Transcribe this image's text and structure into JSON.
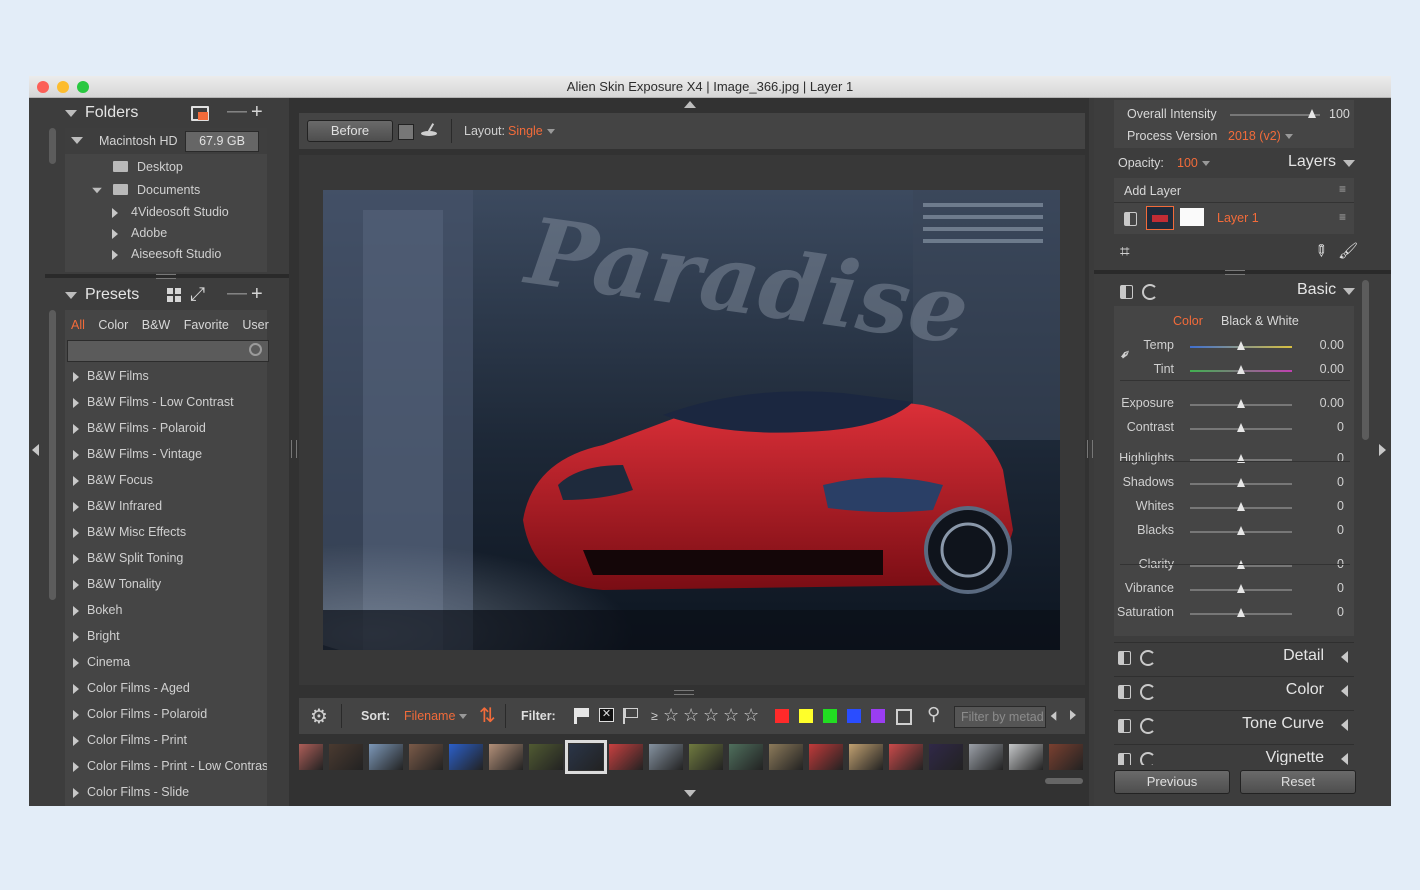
{
  "window": {
    "title": "Alien Skin Exposure X4 | Image_366.jpg | Layer 1"
  },
  "folders": {
    "header": "Folders",
    "drive_name": "Macintosh HD",
    "drive_size": "67.9 GB",
    "items": [
      {
        "label": "Desktop"
      },
      {
        "label": "Documents"
      },
      {
        "label": "4Videosoft Studio"
      },
      {
        "label": "Adobe"
      },
      {
        "label": "Aiseesoft Studio"
      }
    ]
  },
  "presets": {
    "header": "Presets",
    "filter_tabs": [
      "All",
      "Color",
      "B&W",
      "Favorite",
      "User"
    ],
    "active_tab": "All",
    "search_placeholder": "",
    "items": [
      "B&W Films",
      "B&W Films - Low Contrast",
      "B&W Films - Polaroid",
      "B&W Films - Vintage",
      "B&W Focus",
      "B&W Infrared",
      "B&W Misc Effects",
      "B&W Split Toning",
      "B&W Tonality",
      "Bokeh",
      "Bright",
      "Cinema",
      "Color Films - Aged",
      "Color Films - Polaroid",
      "Color Films - Print",
      "Color Films - Print - Low Contrast",
      "Color Films - Slide"
    ]
  },
  "toolbar": {
    "before_label": "Before",
    "layout_label": "Layout:",
    "layout_value": "Single"
  },
  "image": {
    "title_text": "Paradise"
  },
  "filmstrip_bar": {
    "sort_label": "Sort:",
    "sort_value": "Filename",
    "filter_label": "Filter:",
    "rating_prefix": "≥",
    "filter_placeholder": "Filter by metad",
    "color_labels": [
      "#ff2a2a",
      "#ffff2a",
      "#22dd22",
      "#2a4dff",
      "#9a3df2"
    ]
  },
  "thumbnails": [
    {
      "color": "#c96a63"
    },
    {
      "color": "#4a3a30"
    },
    {
      "color": "#7c98b8"
    },
    {
      "color": "#7a5a48"
    },
    {
      "color": "#2b5fc9"
    },
    {
      "color": "#b28f78"
    },
    {
      "color": "#505a32"
    },
    {
      "color": "#2a3548"
    },
    {
      "color": "#c84040"
    },
    {
      "color": "#8592a0"
    },
    {
      "color": "#6f7a3f"
    },
    {
      "color": "#4f6f5d"
    },
    {
      "color": "#8c7a5a"
    },
    {
      "color": "#c03a3a"
    },
    {
      "color": "#c0a070"
    },
    {
      "color": "#c94a4a"
    },
    {
      "color": "#302848"
    },
    {
      "color": "#9ba0a8"
    },
    {
      "color": "#c4c6c8"
    },
    {
      "color": "#7a4030"
    }
  ],
  "right": {
    "overall_intensity_label": "Overall Intensity",
    "overall_intensity_value": "100",
    "overall_intensity_level": 1.0,
    "process_version_label": "Process Version",
    "process_version_value": "2018 (v2)",
    "opacity_label": "Opacity:",
    "opacity_value": "100",
    "layers_header": "Layers",
    "add_layer": "Add Layer",
    "layer_name": "Layer 1",
    "basic_header": "Basic",
    "basic_tabs": [
      "Color",
      "Black & White"
    ],
    "basic_sliders": [
      {
        "name": "Temp",
        "value": "0.00"
      },
      {
        "name": "Tint",
        "value": "0.00"
      },
      {
        "name": "Exposure",
        "value": "0.00"
      },
      {
        "name": "Contrast",
        "value": "0"
      },
      {
        "name": "Highlights",
        "value": "0"
      },
      {
        "name": "Shadows",
        "value": "0"
      },
      {
        "name": "Whites",
        "value": "0"
      },
      {
        "name": "Blacks",
        "value": "0"
      },
      {
        "name": "Clarity",
        "value": "0"
      },
      {
        "name": "Vibrance",
        "value": "0"
      },
      {
        "name": "Saturation",
        "value": "0"
      }
    ],
    "sections": [
      "Detail",
      "Color",
      "Tone Curve",
      "Vignette"
    ],
    "previous_label": "Previous",
    "reset_label": "Reset"
  }
}
